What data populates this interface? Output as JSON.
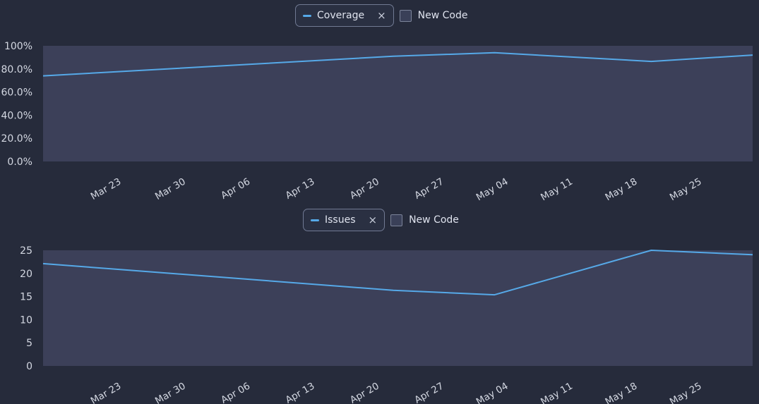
{
  "colors": {
    "background": "#262b3b",
    "plot_area": "#3c4059",
    "line": "#56a9e8",
    "axis_text": "#d4d8e2"
  },
  "charts": [
    {
      "legend": {
        "series_label": "Coverage",
        "close_icon": "×",
        "secondary_label": "New Code"
      }
    },
    {
      "legend": {
        "series_label": "Issues",
        "close_icon": "×",
        "secondary_label": "New Code"
      }
    }
  ],
  "chart_data": [
    {
      "type": "line",
      "x_tick_labels": [
        "Mar 23",
        "Mar 30",
        "Apr 06",
        "Apr 13",
        "Apr 20",
        "Apr 27",
        "May 04",
        "May 11",
        "May 18",
        "May 25"
      ],
      "y_tick_labels": [
        "100%",
        "80.0%",
        "60.0%",
        "40.0%",
        "20.0%",
        "0.0%"
      ],
      "ylim": [
        0,
        100
      ],
      "grid": false,
      "series": [
        {
          "name": "Coverage",
          "points": [
            {
              "x": "Mar 16",
              "y": 74
            },
            {
              "x": "Apr 23",
              "y": 91
            },
            {
              "x": "May 04",
              "y": 94
            },
            {
              "x": "May 21",
              "y": 86.5
            },
            {
              "x": "Jun 01",
              "y": 92
            }
          ]
        }
      ]
    },
    {
      "type": "line",
      "x_tick_labels": [
        "Mar 23",
        "Mar 30",
        "Apr 06",
        "Apr 13",
        "Apr 20",
        "Apr 27",
        "May 04",
        "May 11",
        "May 18",
        "May 25"
      ],
      "y_tick_labels": [
        "25",
        "20",
        "15",
        "10",
        "5",
        "0"
      ],
      "ylim": [
        0,
        26
      ],
      "grid": false,
      "series": [
        {
          "name": "Issues",
          "points": [
            {
              "x": "Mar 16",
              "y": 23
            },
            {
              "x": "Apr 23",
              "y": 17
            },
            {
              "x": "May 04",
              "y": 16
            },
            {
              "x": "May 21",
              "y": 26
            },
            {
              "x": "Jun 01",
              "y": 25
            }
          ]
        }
      ]
    }
  ]
}
